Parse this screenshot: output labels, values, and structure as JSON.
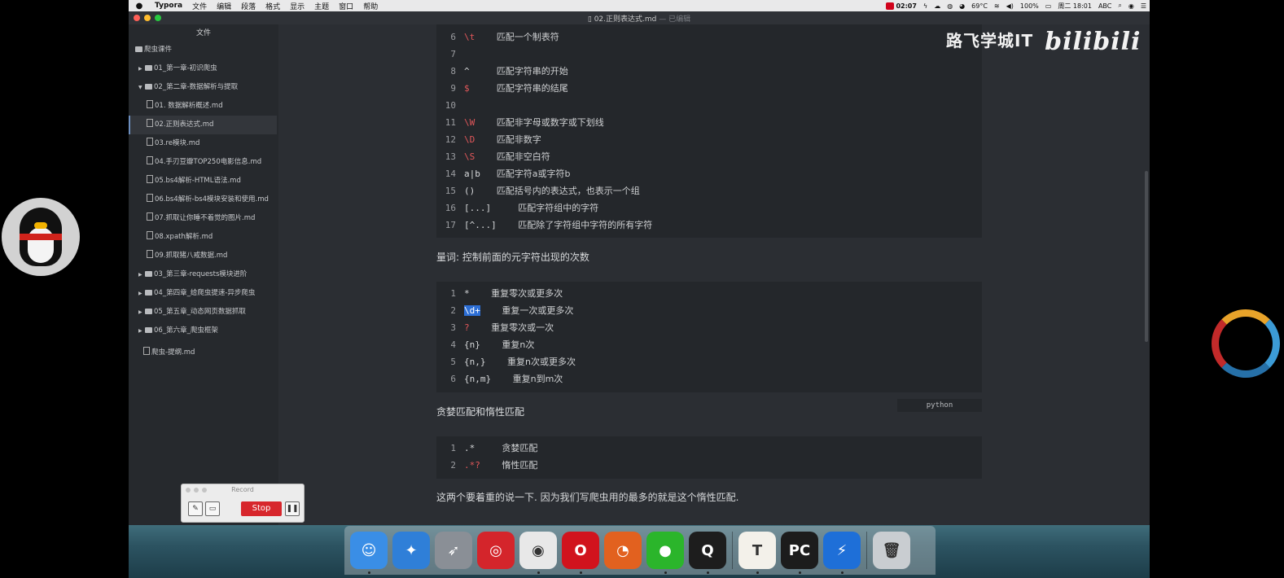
{
  "menubar": {
    "app": "Typora",
    "items": [
      "文件",
      "编辑",
      "段落",
      "格式",
      "显示",
      "主题",
      "窗口",
      "帮助"
    ],
    "status": {
      "recording_time": "02:07",
      "temp": "69°C",
      "battery": "100%",
      "clock": "周二 18:01",
      "input": "ABC"
    }
  },
  "window": {
    "title": "02.正则表达式.md",
    "edited": "— 已编辑"
  },
  "sidebar": {
    "header": "文件",
    "items": [
      {
        "label": "爬虫课件"
      },
      {
        "label": "01_第一章-初识爬虫"
      },
      {
        "label": "02_第二章-数据解析与提取"
      },
      {
        "label": "01. 数据解析概述.md"
      },
      {
        "label": "02.正则表达式.md"
      },
      {
        "label": "03.re模块.md"
      },
      {
        "label": "04.手刃豆瓣TOP250电影信息.md"
      },
      {
        "label": "05.bs4解析-HTML语法.md"
      },
      {
        "label": "06.bs4解析-bs4模块安装和使用.md"
      },
      {
        "label": "07.抓取让你睡不着觉的图片.md"
      },
      {
        "label": "08.xpath解析.md"
      },
      {
        "label": "09.抓取猪八戒数据.md"
      },
      {
        "label": "03_第三章-requests模块进阶"
      },
      {
        "label": "04_第四章_给爬虫提速-异步爬虫"
      },
      {
        "label": "05_第五章_动态网页数据抓取"
      },
      {
        "label": "06_第六章_爬虫框架"
      },
      {
        "label": "爬虫-提纲.md"
      }
    ]
  },
  "editor": {
    "block1": [
      {
        "n": "6",
        "code": "\\t",
        "desc": "匹配一个制表符"
      },
      {
        "n": "7",
        "code": "",
        "desc": ""
      },
      {
        "n": "8",
        "code": "^",
        "desc": "匹配字符串的开始"
      },
      {
        "n": "9",
        "code": "$",
        "desc": "匹配字符串的结尾"
      },
      {
        "n": "10",
        "code": "",
        "desc": ""
      },
      {
        "n": "11",
        "code": "\\W",
        "desc": "匹配非字母或数字或下划线"
      },
      {
        "n": "12",
        "code": "\\D",
        "desc": "匹配非数字"
      },
      {
        "n": "13",
        "code": "\\S",
        "desc": "匹配非空白符"
      },
      {
        "n": "14",
        "code": "a|b",
        "desc": "匹配字符a或字符b"
      },
      {
        "n": "15",
        "code": "()",
        "desc": "匹配括号内的表达式，也表示一个组"
      },
      {
        "n": "16",
        "code": "[...]",
        "desc": "匹配字符组中的字符"
      },
      {
        "n": "17",
        "code": "[^...]",
        "desc": "匹配除了字符组中字符的所有字符"
      }
    ],
    "heading_quantifier": "量词: 控制前面的元字符出现的次数",
    "block2": [
      {
        "n": "1",
        "code": "*",
        "desc": "重复零次或更多次"
      },
      {
        "n": "2",
        "code": "\\d+",
        "desc": "重复一次或更多次"
      },
      {
        "n": "3",
        "code": "?",
        "desc": "重复零次或一次"
      },
      {
        "n": "4",
        "code": "{n}",
        "desc": "重复n次"
      },
      {
        "n": "5",
        "code": "{n,}",
        "desc": "重复n次或更多次"
      },
      {
        "n": "6",
        "code": "{n,m}",
        "desc": "重复n到m次"
      }
    ],
    "lang_badge": "python",
    "heading_greedy": "贪婪匹配和惰性匹配",
    "block3": [
      {
        "n": "1",
        "code": ".*",
        "desc": "贪婪匹配"
      },
      {
        "n": "2",
        "code": ".*?",
        "desc": "惰性匹配"
      }
    ],
    "note": "这两个要着重的说一下. 因为我们写爬虫用的最多的就是这个惰性匹配."
  },
  "watermark": {
    "text": "路飞学城IT",
    "brand": "bilibili"
  },
  "record_widget": {
    "title": "Record",
    "stop": "Stop"
  },
  "dock": {
    "apps": [
      {
        "name": "finder-icon",
        "color": "#3a8ee6",
        "glyph": "☺"
      },
      {
        "name": "safari-icon",
        "color": "#2f7fd8",
        "glyph": "✦"
      },
      {
        "name": "launchpad-icon",
        "color": "#8a8f96",
        "glyph": "➶"
      },
      {
        "name": "netease-music-icon",
        "color": "#d4252b",
        "glyph": "◎"
      },
      {
        "name": "chrome-icon",
        "color": "#e8e8e8",
        "glyph": "◉"
      },
      {
        "name": "opera-icon",
        "color": "#d1131d",
        "glyph": "O"
      },
      {
        "name": "firefox-icon",
        "color": "#e2611f",
        "glyph": "◔"
      },
      {
        "name": "wechat-icon",
        "color": "#2bb52b",
        "glyph": "●"
      },
      {
        "name": "qq-icon",
        "color": "#1d1d1d",
        "glyph": "Q"
      },
      {
        "name": "typora-icon",
        "color": "#f3f1ea",
        "glyph": "T"
      },
      {
        "name": "pycharm-icon",
        "color": "#1c1c1c",
        "glyph": "PC"
      },
      {
        "name": "thunder-icon",
        "color": "#1e6fd8",
        "glyph": "⚡"
      },
      {
        "name": "trash-icon",
        "color": "#c9cdd1",
        "glyph": "🗑"
      }
    ]
  },
  "colors": {
    "accent": "#2d6fd6",
    "regex_red": "#e2575a",
    "stop_red": "#d7262c"
  }
}
